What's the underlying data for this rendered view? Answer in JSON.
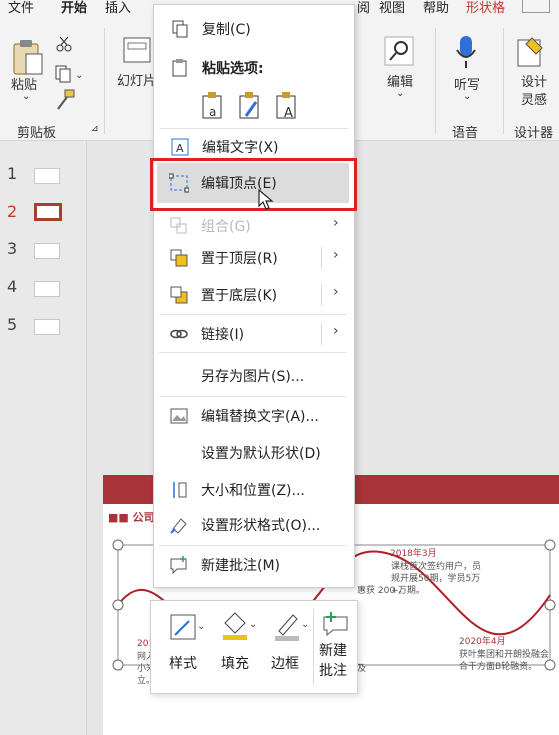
{
  "ribbon": {
    "tabs": [
      "文件",
      "开始",
      "插入",
      "阅",
      "视图",
      "帮助",
      "形状格"
    ],
    "clipboard": {
      "paste_label": "粘贴",
      "group_label": "剪贴板"
    },
    "slides": {
      "new_slide_label": "幻灯片"
    },
    "editing": {
      "label": "编辑"
    },
    "voice": {
      "dictate_label": "听写",
      "group_label": "语音"
    },
    "designer": {
      "label": "设计灵感",
      "group_label": "设计器"
    }
  },
  "thumbnails": [
    {
      "num": "1",
      "active": false
    },
    {
      "num": "2",
      "active": true
    },
    {
      "num": "3",
      "active": false
    },
    {
      "num": "4",
      "active": false
    },
    {
      "num": "5",
      "active": false
    }
  ],
  "slide": {
    "title": "公司",
    "events": [
      {
        "date": "2018年3月",
        "text": "课栈首次签约用户，员规开展50期，学员5万+。"
      },
      {
        "date": "2020年4月",
        "text": "获叶集团和开朗投融会合干方面B轮融资。"
      },
      {
        "date": "201",
        "text": "网入 小米 立。"
      }
    ],
    "snippet": "惠获 200 万期。",
    "snippet2": "及"
  },
  "context_menu": {
    "copy": "复制(C)",
    "paste_options": "粘贴选项:",
    "edit_text": "编辑文字(X)",
    "edit_points": "编辑顶点(E)",
    "group": "组合(G)",
    "bring_to_front": "置于顶层(R)",
    "send_to_back": "置于底层(K)",
    "link": "链接(I)",
    "save_as_picture": "另存为图片(S)...",
    "edit_alt_text": "编辑替换文字(A)...",
    "set_default_shape": "设置为默认形状(D)",
    "size_position": "大小和位置(Z)...",
    "format_shape": "设置形状格式(O)...",
    "new_comment": "新建批注(M)"
  },
  "mini_toolbar": {
    "style": "样式",
    "fill": "填充",
    "outline": "边框",
    "new_comment": "新建批注"
  },
  "colors": {
    "accent": "#c0392b",
    "highlight_box": "#e02020",
    "slide_band": "#a8343a",
    "fill_swatch": "#f0c020",
    "shape_curve": "#b01e2a"
  }
}
